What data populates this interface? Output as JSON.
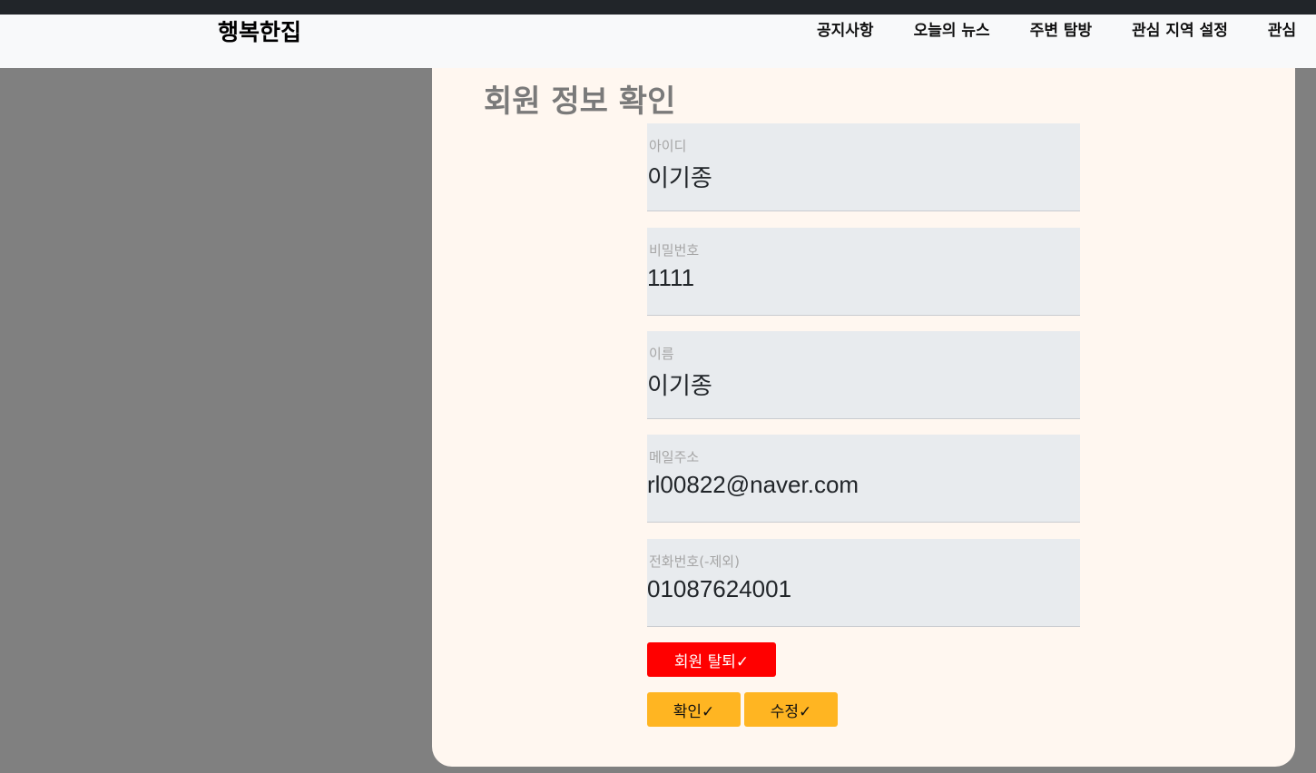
{
  "nav": {
    "brand": "행복한집",
    "items": [
      "공지사항",
      "오늘의 뉴스",
      "주변 탐방",
      "관심 지역 설정",
      "관심"
    ]
  },
  "page": {
    "title": "회원 정보 확인"
  },
  "fields": [
    {
      "label": "아이디",
      "value": "이기종"
    },
    {
      "label": "비밀번호",
      "value": "1111"
    },
    {
      "label": "이름",
      "value": "이기종"
    },
    {
      "label": "메일주소",
      "value": "rl00822@naver.com"
    },
    {
      "label": "전화번호(-제외)",
      "value": "01087624001"
    }
  ],
  "buttons": {
    "withdraw": "회원 탈퇴✓",
    "confirm": "확인✓",
    "edit": "수정✓"
  },
  "colors": {
    "danger": "#ff0000",
    "warning": "#ffb522",
    "card": "#fff7f0",
    "backdrop": "#808080"
  }
}
